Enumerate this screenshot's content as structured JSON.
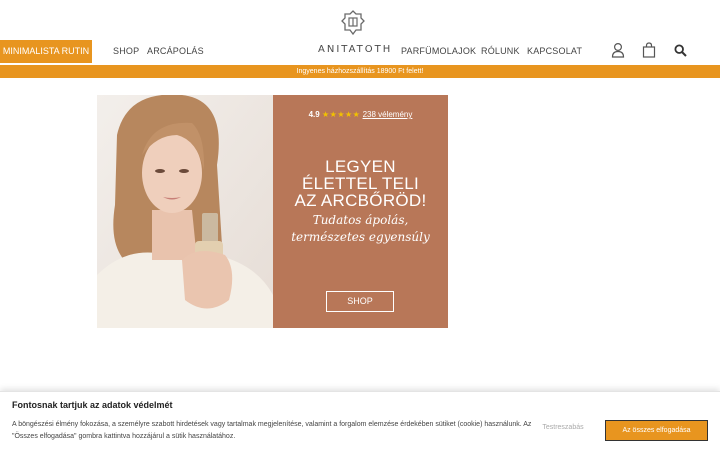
{
  "header": {
    "promo_button": "MINIMALISTA RUTIN",
    "brand": "ANITATOTH",
    "nav_left": [
      "SHOP",
      "ARCÁPOLÁS"
    ],
    "nav_right": [
      "PARFÜMOLAJOK",
      "RÓLUNK",
      "KAPCSOLAT"
    ],
    "icons": [
      "user-icon",
      "shopping-bag-icon",
      "search-icon"
    ],
    "accent_color": "#e8951f"
  },
  "shipping_bar": {
    "text": "Ingyenes házhozszállítás 18900 Ft felett!"
  },
  "hero": {
    "rating_score": "4.9",
    "rating_stars": "★★★★★",
    "rating_reviews": "238 vélemény",
    "headline_lines": [
      "LEGYEN",
      "ÉLETTEL TELI",
      "AZ ARCBŐRÖD!"
    ],
    "subline_lines": [
      "Tudatos ápolás,",
      "természetes egyensúly"
    ],
    "cta": "SHOP",
    "panel_color": "#b87758"
  },
  "cookie_banner": {
    "title": "Fontosnak tartjuk az adatok védelmét",
    "text": "A böngészési élmény fokozása, a személyre szabott hirdetések vagy tartalmak megjelenítése, valamint a forgalom elemzése érdekében sütiket (cookie) használunk. Az \"Összes elfogadása\" gombra kattintva hozzájárul a sütik használatához.",
    "customize": "Testreszabás",
    "accept_all": "Az összes elfogadása"
  }
}
